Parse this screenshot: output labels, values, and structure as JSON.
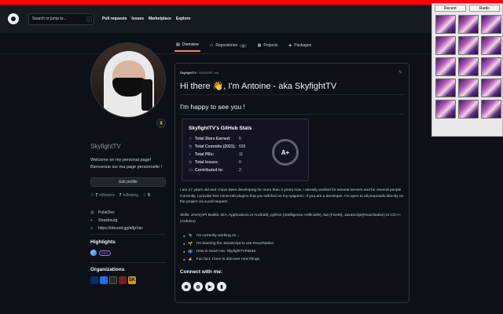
{
  "topnav": {
    "search_placeholder": "Search or jump to...",
    "search_shortcut": "/",
    "links": [
      "Pull requests",
      "Issues",
      "Marketplace",
      "Explore"
    ]
  },
  "tabs": [
    {
      "label": "Overview",
      "icon": "book-icon"
    },
    {
      "label": "Repositories",
      "count": "1",
      "icon": "repo-icon"
    },
    {
      "label": "Projects",
      "icon": "table-icon"
    },
    {
      "label": "Packages",
      "icon": "package-icon"
    }
  ],
  "profile": {
    "username": "SkyfightTV",
    "bio": "Welcome on my personal page! Bienvenue sur ma page personnelle !",
    "edit_button": "Edit profile",
    "followers_count": "7",
    "followers_label": "followers",
    "following_count": "7",
    "following_label": "following",
    "stars": "5",
    "company": "PolarDev",
    "location": "Strasbourg",
    "website": "https://discord.gg/a8jzVac"
  },
  "highlights": {
    "title": "Highlights",
    "pro_label": "PRO"
  },
  "organizations": {
    "title": "Organizations",
    "sk_label": "SK"
  },
  "readme": {
    "path_user": "SkyfightTV",
    "path_file": "/ README .md",
    "h1": "Hi there 👋, I'm Antoine - aka SkyfightTV",
    "h2": "I'm happy to see you !",
    "stats": {
      "title": "SkyfightTV's GitHub Stats",
      "rows": [
        {
          "label": "Total Stars Earned:",
          "value": "5"
        },
        {
          "label": "Total Commits (2021):",
          "value": "658"
        },
        {
          "label": "Total PRs:",
          "value": "11"
        },
        {
          "label": "Total Issues:",
          "value": "0"
        },
        {
          "label": "Contributed to:",
          "value": "2"
        }
      ],
      "grade": "A+"
    },
    "paragraph1": "I am 17 years old and I have been developing for more than 2 years now. I already worked for several servers and for several people . Currently, I provide free minecraft plugins that you will find on my spigotmc. If you are a developer, I'm open to all proposals directly on the project via a pull request.",
    "paragraph2": "Skills: JAVA(API Bukkit, IDA, Applications et Android), python (Intelligence Artificielle), lua (FiveM), JavaScript(ReactNative) et C/C++ (Arduino)",
    "list": [
      {
        "emoji": "🔭",
        "text": "I’m currently working on ..."
      },
      {
        "emoji": "🌱",
        "text": "I’m learning the JavaScript to use ReactNative."
      },
      {
        "emoji": "📫",
        "text": "How to reach me: SkyfightTV#9535"
      },
      {
        "emoji": "⚡",
        "text": "Fun fact: I love to discover new things."
      }
    ],
    "connect_title": "Connect with me:"
  },
  "extension": {
    "tabs": [
      "Recent",
      "Radio"
    ]
  },
  "colors": {
    "accent": "#f78166",
    "redbar": "#ff0000",
    "background": "#0d1117"
  }
}
